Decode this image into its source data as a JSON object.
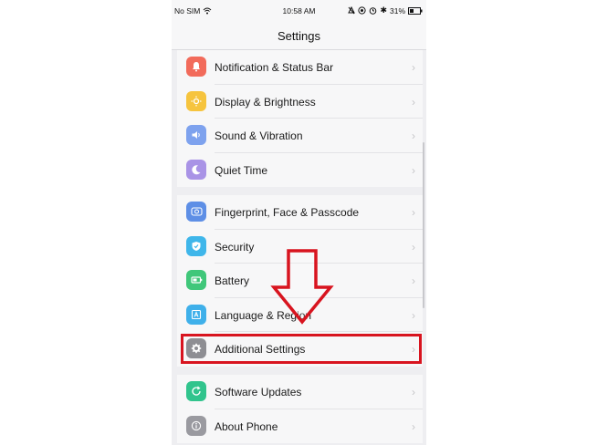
{
  "status_bar": {
    "carrier": "No SIM",
    "time": "10:58 AM",
    "battery": "31%",
    "icons": [
      "wifi-icon",
      "silent-icon",
      "camera-icon",
      "alarm-icon",
      "bluetooth-icon",
      "battery-icon"
    ]
  },
  "nav": {
    "title": "Settings"
  },
  "groups": [
    {
      "items": [
        {
          "label": "Notification & Status Bar",
          "icon": "notification-icon",
          "color": "#f26b5b"
        },
        {
          "label": "Display & Brightness",
          "icon": "brightness-icon",
          "color": "#f6c43e"
        },
        {
          "label": "Sound & Vibration",
          "icon": "speaker-icon",
          "color": "#7ea2ee"
        },
        {
          "label": "Quiet Time",
          "icon": "moon-icon",
          "color": "#a993e6"
        }
      ]
    },
    {
      "items": [
        {
          "label": "Fingerprint, Face & Passcode",
          "icon": "fingerprint-icon",
          "color": "#5e8fe6"
        },
        {
          "label": "Security",
          "icon": "shield-icon",
          "color": "#3fb6ea"
        },
        {
          "label": "Battery",
          "icon": "battery-icon",
          "color": "#40c77a"
        },
        {
          "label": "Language & Region",
          "icon": "language-icon",
          "color": "#3fb0ea"
        },
        {
          "label": "Additional Settings",
          "icon": "gear-icon",
          "color": "#8e8e93"
        }
      ]
    },
    {
      "items": [
        {
          "label": "Software Updates",
          "icon": "update-icon",
          "color": "#31c48d"
        },
        {
          "label": "About Phone",
          "icon": "info-icon",
          "color": "#9a9aa0"
        }
      ]
    }
  ],
  "annotations": {
    "highlight_color": "#d8141f",
    "arrow_color": "#d8141f"
  }
}
